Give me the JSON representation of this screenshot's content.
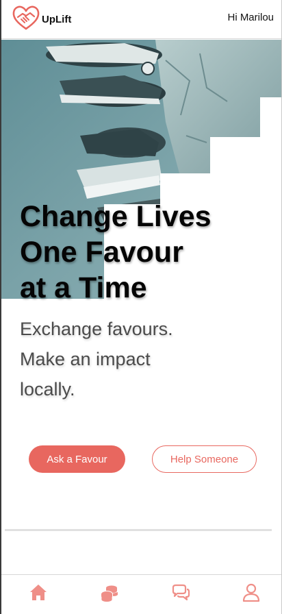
{
  "app": {
    "brand": "UpLift",
    "greeting": "Hi Marilou",
    "accent_color": "#e8675f"
  },
  "hero": {
    "headline_lines": [
      "Change Lives",
      "One Favour",
      "at a Time"
    ],
    "subtitle_lines": [
      "Exchange favours.",
      "Make an impact",
      "locally."
    ],
    "photo": "sneakers on stone steps"
  },
  "actions": {
    "ask_label": "Ask a Favour",
    "help_label": "Help Someone"
  },
  "bottom_nav": {
    "items": [
      {
        "icon": "home-icon"
      },
      {
        "icon": "coins-icon"
      },
      {
        "icon": "chat-icon"
      },
      {
        "icon": "profile-icon"
      }
    ]
  }
}
